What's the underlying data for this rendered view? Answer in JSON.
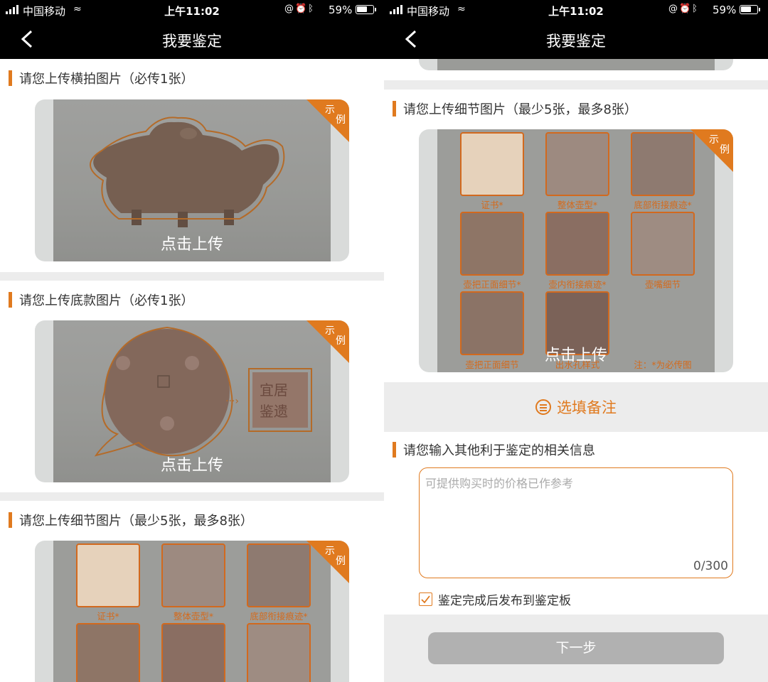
{
  "status": {
    "carrier": "中国移动",
    "time": "上午11:02",
    "battery": "59%"
  },
  "nav": {
    "title": "我要鉴定"
  },
  "sections": {
    "horizontal": {
      "title": "请您上传横拍图片（必传1张）",
      "upload": "点击上传"
    },
    "bottom": {
      "title": "请您上传底款图片（必传1张）",
      "upload": "点击上传"
    },
    "details": {
      "title": "请您上传细节图片（最少5张，最多8张）",
      "upload": "点击上传"
    }
  },
  "example_badge": {
    "line1": "示",
    "line2": "例"
  },
  "detail_captions": [
    "证书*",
    "整体壶型*",
    "底部衔接痕迹*",
    "壶把正面细节*",
    "壶内衔接痕迹*",
    "壶嘴细节",
    "壶把正面细节",
    "出水孔样式"
  ],
  "detail_note": "注：*为必传图",
  "remark": {
    "label": "选填备注"
  },
  "info": {
    "title": "请您输入其他利于鉴定的相关信息",
    "placeholder": "可提供购买时的价格已作参考",
    "count": "0/300"
  },
  "publish": {
    "label": "鉴定完成后发布到鉴定板",
    "checked": true
  },
  "next": {
    "label": "下一步"
  },
  "colors": {
    "accent": "#e07a1f",
    "caption": "#d46a1c",
    "disabled_button": "#b1b1b1"
  }
}
